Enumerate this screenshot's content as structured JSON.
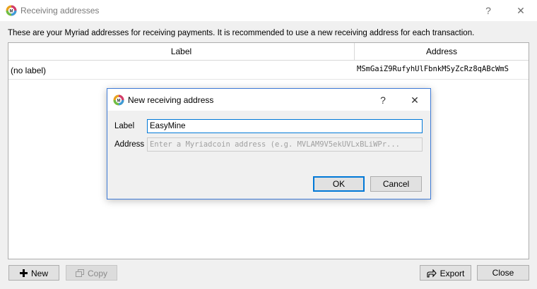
{
  "window": {
    "title": "Receiving addresses",
    "help_glyph": "?",
    "close_glyph": "✕",
    "logo_icon": "myriad-logo-icon"
  },
  "intro_text": "These are your Myriad addresses for receiving payments. It is recommended to use a new receiving address for each transaction.",
  "table": {
    "sort_indicator": "^",
    "columns": [
      "Label",
      "Address"
    ],
    "rows": [
      {
        "label": "(no label)",
        "address": "MSmGaiZ9RufyhUlFbnkMSyZcRz8qABcWmS"
      }
    ]
  },
  "buttons": {
    "new": {
      "label": "New",
      "icon": "plus-icon"
    },
    "copy": {
      "label": "Copy",
      "icon": "copy-icon",
      "disabled": true
    },
    "export": {
      "label": "Export",
      "icon": "export-icon"
    },
    "close": {
      "label": "Close"
    }
  },
  "dialog": {
    "title": "New receiving address",
    "help_glyph": "?",
    "close_glyph": "✕",
    "label_field": {
      "label": "Label",
      "value": "EasyMine"
    },
    "address_field": {
      "label": "Address",
      "placeholder": "Enter a Myriadcoin address (e.g. MVLAM9V5ekUVLxBLiWPr..."
    },
    "ok_label": "OK",
    "cancel_label": "Cancel"
  },
  "colors": {
    "accent": "#0078d7",
    "dialog_border": "#3d7ad6",
    "window_bg": "#f0f0f0"
  }
}
